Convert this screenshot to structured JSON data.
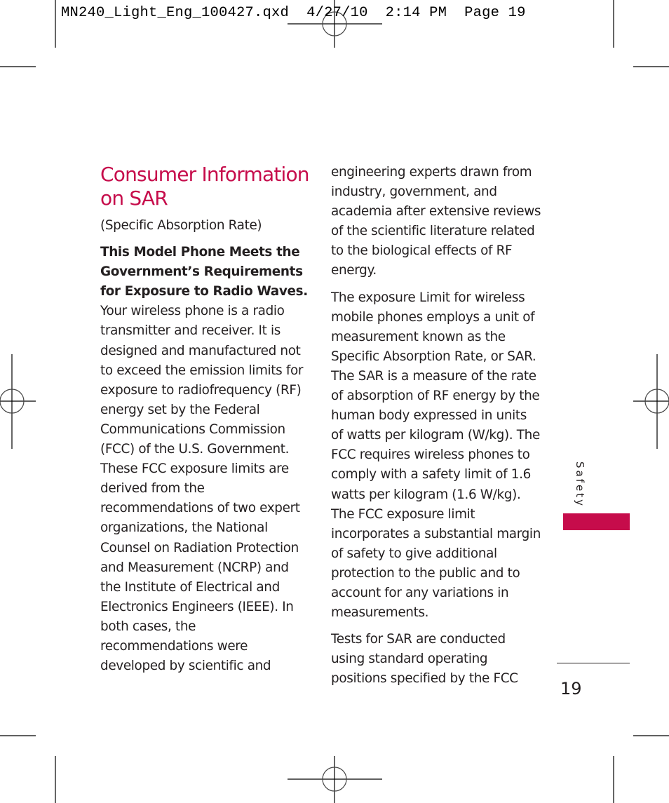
{
  "slug": {
    "filename": "MN240_Light_Eng_100427.qxd",
    "date": "4/27/10",
    "time": "2:14 PM",
    "page_label": "Page 19"
  },
  "section": {
    "title_line1": "Consumer Information",
    "title_line2": "on SAR",
    "subtitle": "(Specific Absorption Rate)",
    "lead_bold": "This Model Phone Meets the Government’s Requirements for Exposure to Radio Waves.",
    "lead_rest": " Your wireless phone is a radio transmitter and receiver. It is designed and manufactured not to exceed the emission limits for exposure to radiofrequency (RF) energy set by the Federal Communications Commission (FCC) of the U.S. Government. These FCC exposure limits are derived from the recommendations of two expert organizations, the National Counsel on Radiation Protection and Measurement (NCRP) and the Institute of Electrical and Electronics Engineers (IEEE). In both cases, the recommendations were developed by scientific and",
    "right_p1": "engineering experts drawn from industry, government, and academia after extensive reviews of the scientific literature related to the biological effects of RF energy.",
    "right_p2": "The exposure Limit for wireless mobile phones employs a unit of measurement known as the Specific Absorption Rate, or SAR. The SAR is a measure of the rate of absorption of RF energy by the human body expressed in units of watts per kilogram (W/kg). The FCC requires wireless phones to comply with a safety limit of 1.6 watts per kilogram (1.6 W/kg). The FCC exposure limit incorporates a substantial margin of safety to give additional protection to the public and to account for any variations in measurements.",
    "right_p3": "Tests for SAR are conducted using standard operating positions specified by the FCC"
  },
  "sidebar": {
    "label": "Safety",
    "accent_color": "#c60c4b"
  },
  "page_number": "19"
}
